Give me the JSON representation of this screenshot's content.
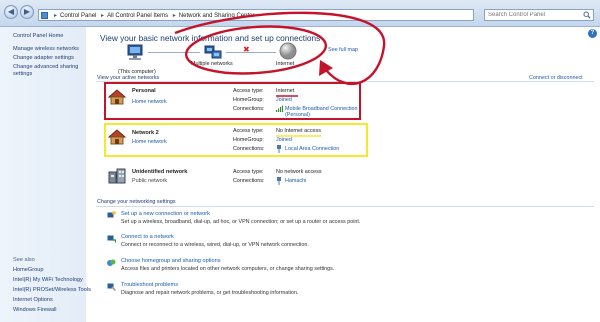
{
  "addressbar": {
    "crumbs": [
      "Control Panel",
      "All Control Panel Items",
      "Network and Sharing Center"
    ],
    "search_placeholder": "Search Control Panel"
  },
  "leftpane": {
    "home": "Control Panel Home",
    "links": [
      "Manage wireless networks",
      "Change adapter settings",
      "Change advanced sharing",
      "settings"
    ],
    "see_also_title": "See also",
    "see_also": [
      "HomeGroup",
      "Intel(R) My WiFi Technology",
      "Intel(R) PROSet/Wireless Tools",
      "Internet Options",
      "Windows Firewall"
    ]
  },
  "main": {
    "title": "View your basic network information and set up connections",
    "see_full_map": "See full map",
    "map": {
      "this_computer": "(This computer)",
      "multiple_networks": "Multiple networks",
      "internet": "Internet"
    },
    "active_networks_title": "View your active networks",
    "connect_disconnect": "Connect or disconnect",
    "labels": {
      "access_type": "Access type:",
      "homegroup": "HomeGroup:",
      "connections": "Connections:"
    },
    "networks": [
      {
        "name": "Personal",
        "type": "Home network",
        "access_type": "Internet",
        "homegroup": "Joined",
        "connection": "Mobile Broadband Connection",
        "connection_line2": "(Personal)"
      },
      {
        "name": "Network  2",
        "type": "Home network",
        "access_type": "No Internet access",
        "homegroup": "Joined",
        "connection": "Local Area Connection"
      },
      {
        "name": "Unidentified network",
        "type": "Public network",
        "access_type": "No network access",
        "connection": "Hamachi"
      }
    ],
    "settings_title": "Change your networking settings",
    "tasks": [
      {
        "link": "Set up a new connection or network",
        "desc": "Set up a wireless, broadband, dial-up, ad hoc, or VPN connection; or set up a router or access point."
      },
      {
        "link": "Connect to a network",
        "desc": "Connect or reconnect to a wireless, wired, dial-up, or VPN network connection."
      },
      {
        "link": "Choose homegroup and sharing options",
        "desc": "Access files and printers located on other network computers, or change sharing settings."
      },
      {
        "link": "Troubleshoot problems",
        "desc": "Diagnose and repair network problems, or get troubleshooting information."
      }
    ]
  },
  "colors": {
    "annotation_red": "#c5132c",
    "annotation_yellow": "#f3ea2e",
    "link_blue": "#1a5bb0"
  }
}
